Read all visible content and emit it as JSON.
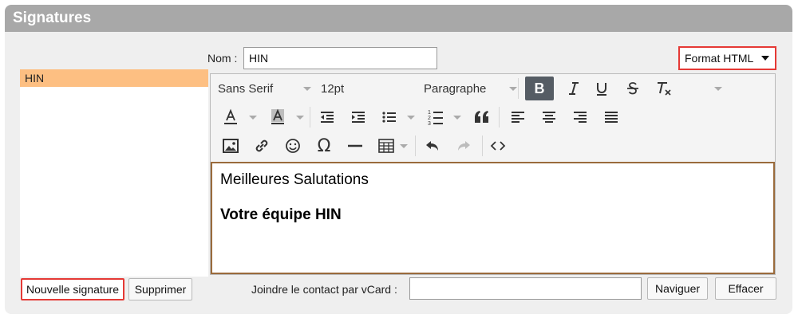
{
  "panel": {
    "title": "Signatures"
  },
  "signatures": {
    "items": [
      {
        "label": "HIN"
      }
    ]
  },
  "form": {
    "nom_label": "Nom :",
    "nom_value": "HIN",
    "format_select": "Format HTML"
  },
  "toolbar": {
    "font_family": "Sans Serif",
    "font_size": "12pt",
    "block_format": "Paragraphe",
    "bold_label": "B",
    "icons": [
      "bold-icon",
      "italic-icon",
      "underline-icon",
      "strikethrough-icon",
      "clear-format-icon",
      "font-color-icon",
      "background-color-icon",
      "outdent-icon",
      "indent-icon",
      "bullet-list-icon",
      "numbered-list-icon",
      "blockquote-icon",
      "align-left-icon",
      "align-center-icon",
      "align-right-icon",
      "align-justify-icon",
      "image-icon",
      "link-icon",
      "emoji-icon",
      "omega-icon",
      "horizontal-rule-icon",
      "table-icon",
      "undo-icon",
      "redo-icon",
      "source-code-icon"
    ]
  },
  "editor": {
    "line1": "Meilleures Salutations",
    "line2": "Votre équipe HIN"
  },
  "footer": {
    "new_signature": "Nouvelle signature",
    "delete": "Supprimer",
    "vcard_label": "Joindre le contact par vCard :",
    "vcard_value": "",
    "browse": "Naviguer",
    "clear": "Effacer"
  },
  "colors": {
    "highlight": "#fdbf82",
    "header": "#a8a8a8",
    "attention_border": "#e53935",
    "editor_border": "#9a6b3c"
  }
}
